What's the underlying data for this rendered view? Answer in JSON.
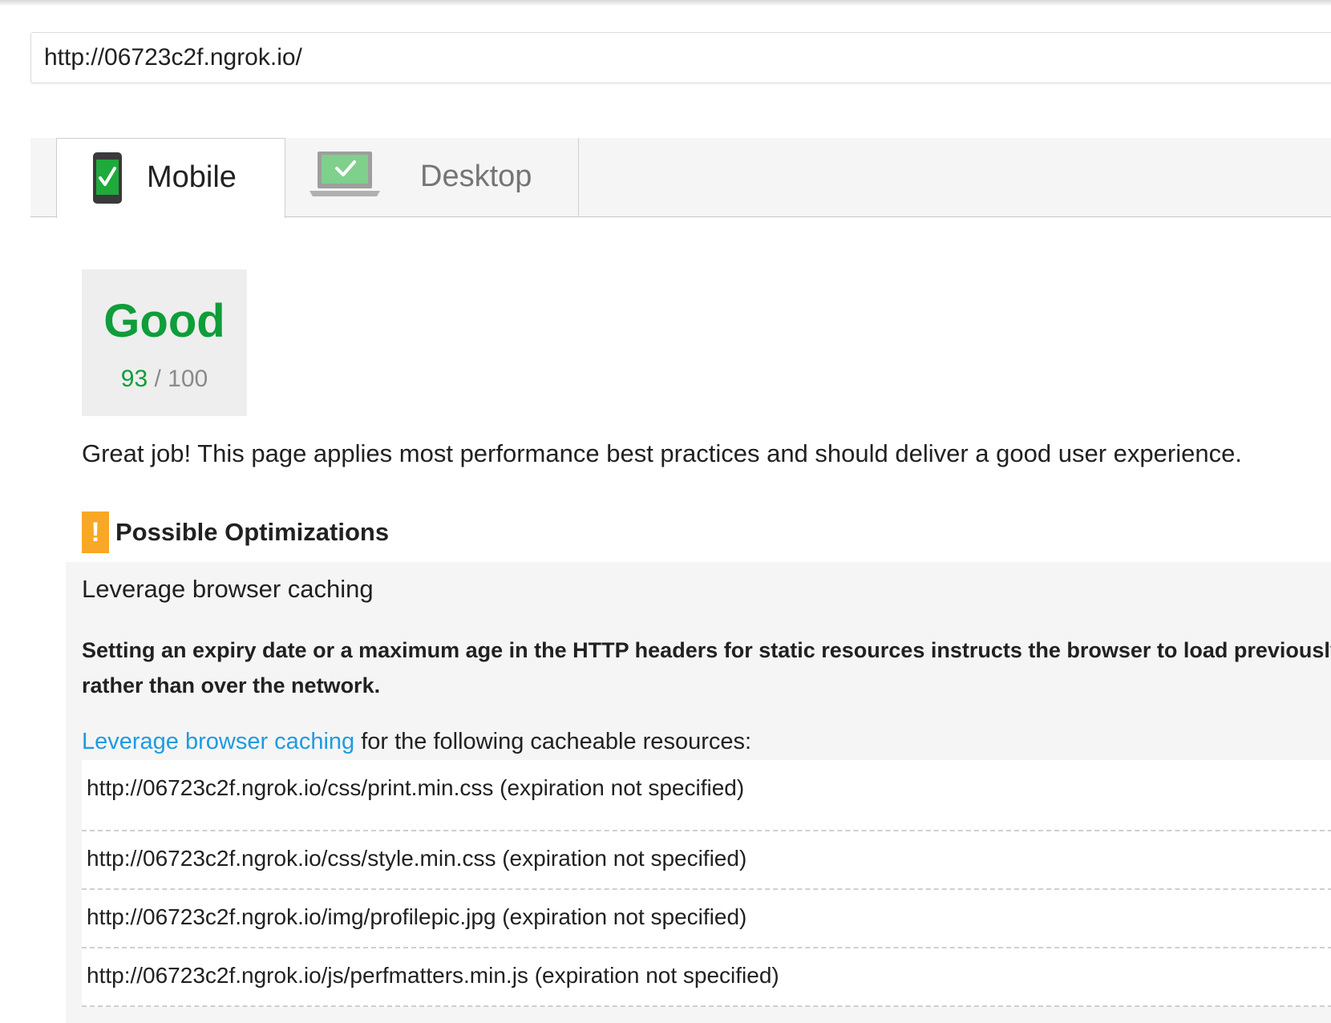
{
  "url_bar": {
    "value": "http://06723c2f.ngrok.io/"
  },
  "tabs": [
    {
      "label": "Mobile",
      "icon": "mobile-check-icon",
      "selected": true
    },
    {
      "label": "Desktop",
      "icon": "desktop-check-icon",
      "selected": false
    }
  ],
  "score": {
    "verdict": "Good",
    "value": "93",
    "separator": " / ",
    "max": "100",
    "color": "#0f9d3a"
  },
  "summary": "Great job! This page applies most performance best practices and should deliver a good user experience.",
  "optimizations": {
    "icon": "warning-icon",
    "icon_glyph": "!",
    "icon_color": "#f9a825",
    "title": "Possible Optimizations",
    "rule": {
      "title": "Leverage browser caching",
      "description_line1": "Setting an expiry date or a maximum age in the HTTP headers for static resources instructs the browser to load previously d",
      "description_line2": "rather than over the network.",
      "intro_link": "Leverage browser caching",
      "intro_rest": " for the following cacheable resources:",
      "link_color": "#1e9be0",
      "resources": [
        "http://06723c2f.ngrok.io/css/print.min.css (expiration not specified)",
        "http://06723c2f.ngrok.io/css/style.min.css (expiration not specified)",
        "http://06723c2f.ngrok.io/img/profilepic.jpg (expiration not specified)",
        "http://06723c2f.ngrok.io/js/perfmatters.min.js (expiration not specified)"
      ]
    }
  }
}
